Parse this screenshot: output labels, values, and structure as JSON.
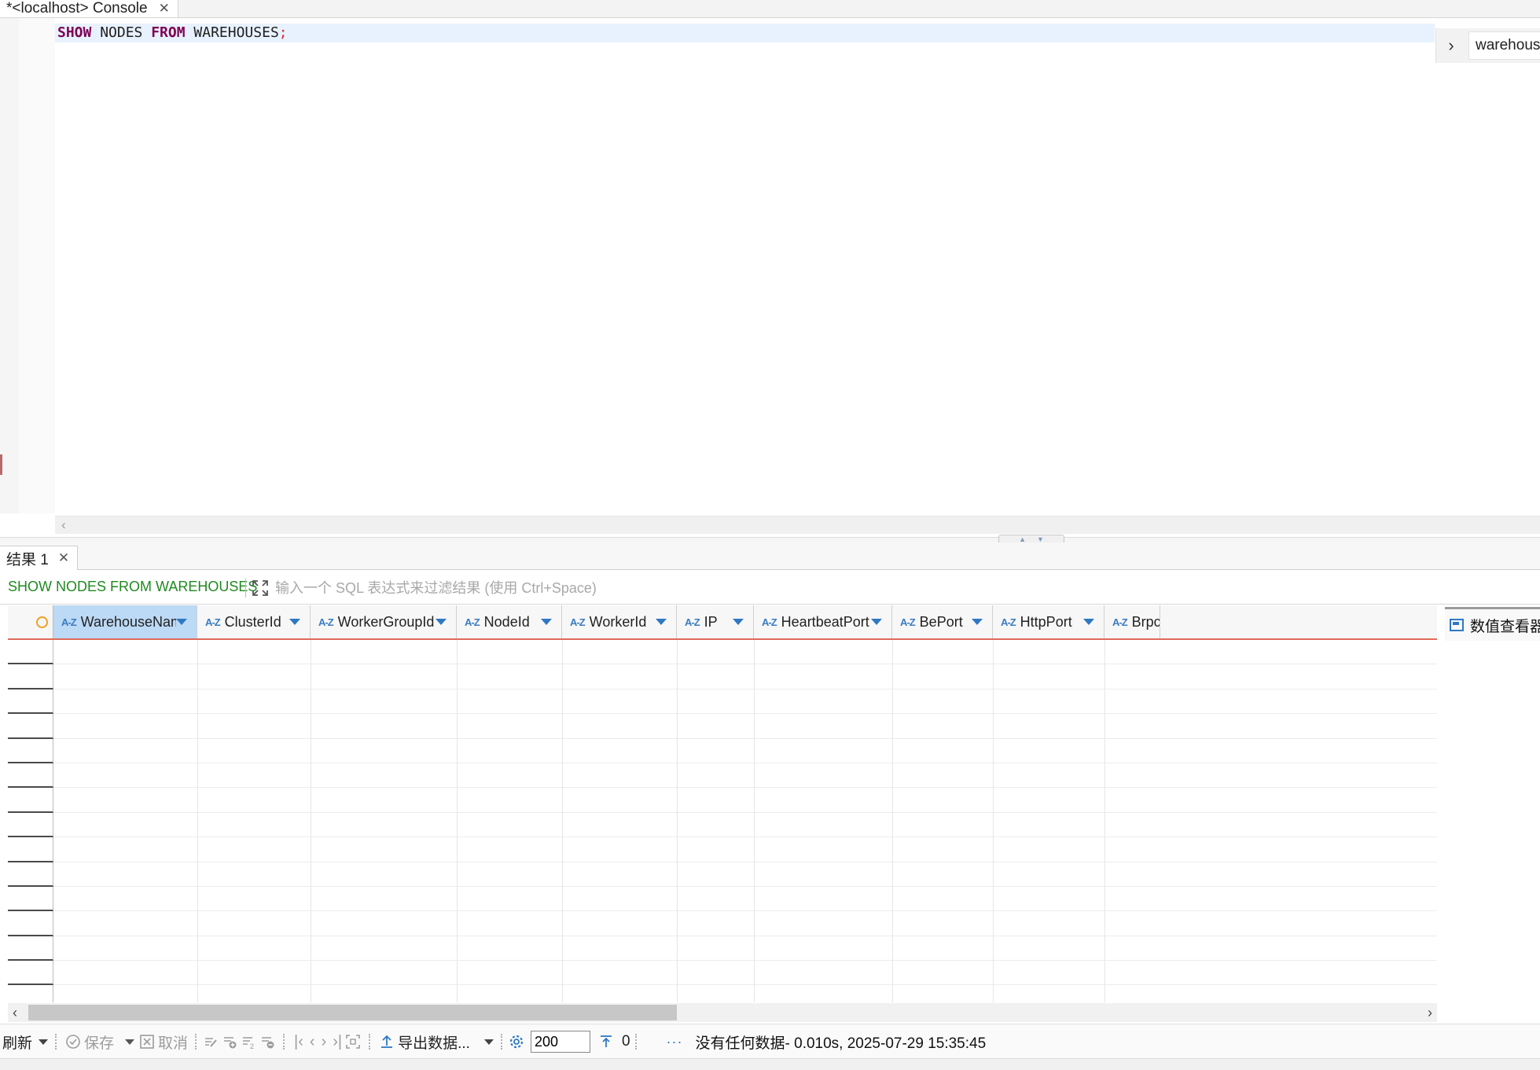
{
  "editor_tab": {
    "title": "*<localhost> Console",
    "close": "✕"
  },
  "editor": {
    "sql_tokens": [
      {
        "text": "SHOW",
        "type": "keyword"
      },
      {
        "text": " NODES ",
        "type": "identifier"
      },
      {
        "text": "FROM",
        "type": "keyword"
      },
      {
        "text": " WAREHOUSES",
        "type": "identifier"
      },
      {
        "text": ";",
        "type": "semicolon"
      }
    ]
  },
  "outline_panel": {
    "expand_glyph": "›",
    "label": "warehous"
  },
  "results_tab": {
    "label": "结果 1",
    "close": "✕"
  },
  "filter_bar": {
    "query_text": "SHOW NODES FROM WAREHOUSES",
    "placeholder": "输入一个 SQL 表达式来过滤结果 (使用 Ctrl+Space)"
  },
  "grid": {
    "type_badge": "A-Z",
    "columns": [
      {
        "name": "WarehouseName",
        "selected": true
      },
      {
        "name": "ClusterId"
      },
      {
        "name": "WorkerGroupId"
      },
      {
        "name": "NodeId"
      },
      {
        "name": "WorkerId"
      },
      {
        "name": "IP"
      },
      {
        "name": "HeartbeatPort"
      },
      {
        "name": "BePort"
      },
      {
        "name": "HttpPort"
      },
      {
        "name": "Brpc"
      }
    ],
    "rows": []
  },
  "side_panel": {
    "label": "数值查看器"
  },
  "toolbar": {
    "refresh": "刷新",
    "save": "保存",
    "cancel": "取消",
    "export": "导出数据...",
    "fetch_size": "200",
    "row_count": "0",
    "status": "没有任何数据- 0.010s, 2025-07-29 15:35:45",
    "more": "···"
  },
  "colors": {
    "accent": "#2f78c4",
    "keyword": "#7f0055",
    "filter_query": "#208a20",
    "header_underline": "#e06a5a",
    "selected_header": "#bcd9f5"
  }
}
